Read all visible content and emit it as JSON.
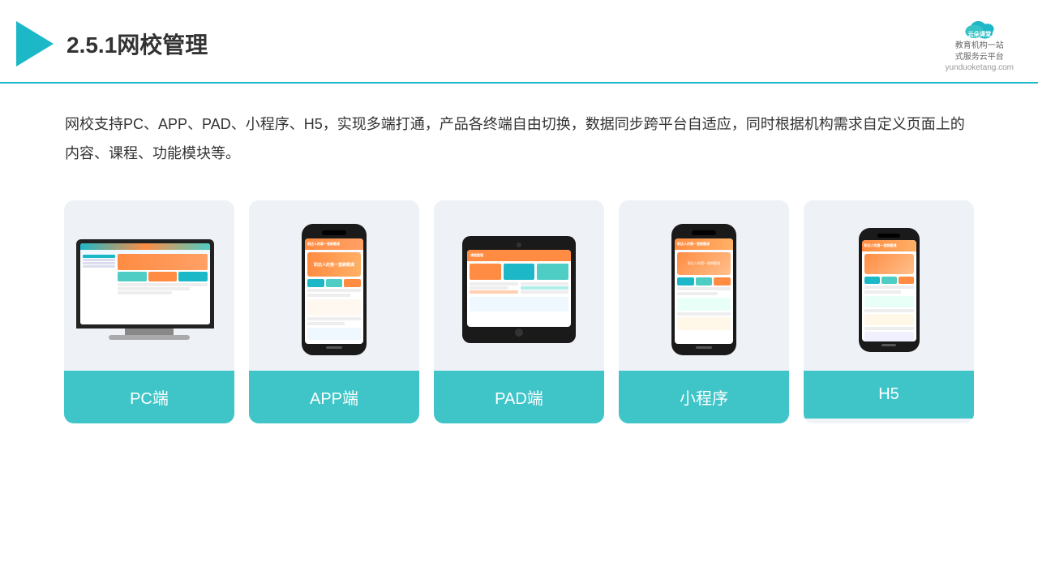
{
  "header": {
    "title": "2.5.1网校管理",
    "brand_name": "云朵课堂",
    "brand_url": "yunduoketang.com",
    "brand_tagline_1": "教育机构一站",
    "brand_tagline_2": "式服务云平台"
  },
  "description": {
    "text": "网校支持PC、APP、PAD、小程序、H5，实现多端打通，产品各终端自由切换，数据同步跨平台自适应，同时根据机构需求自定义页面上的内容、课程、功能模块等。"
  },
  "cards": [
    {
      "id": "pc",
      "label": "PC端"
    },
    {
      "id": "app",
      "label": "APP端"
    },
    {
      "id": "pad",
      "label": "PAD端"
    },
    {
      "id": "miniprogram",
      "label": "小程序"
    },
    {
      "id": "h5",
      "label": "H5"
    }
  ]
}
